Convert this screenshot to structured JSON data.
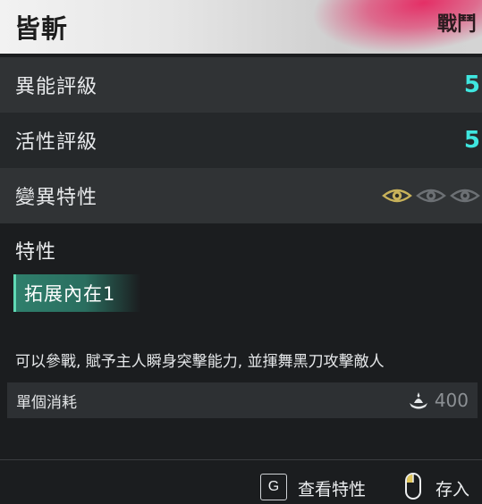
{
  "header": {
    "title": "皆斬",
    "tag": "戰鬥",
    "accent_color": "#e52660"
  },
  "stats": [
    {
      "label": "異能評級",
      "value": "5"
    },
    {
      "label": "活性評級",
      "value": "5"
    }
  ],
  "mutation": {
    "label": "變異特性",
    "icons": [
      "eye-icon-active",
      "eye-icon-inactive",
      "eye-icon-inactive"
    ],
    "active_color": "#c8b25a",
    "inactive_color": "#6c7074"
  },
  "traits": {
    "section_title": "特性",
    "selected": "拓展內在1"
  },
  "description": "可以參戰, 賦予主人瞬身突擊能力, 並揮舞黑刀攻擊敵人",
  "cost": {
    "label": "單個消耗",
    "icon": "resource-icon",
    "value": "400"
  },
  "footer": {
    "view_key": "G",
    "view_label": "查看特性",
    "store_icon": "mouse-icon",
    "store_label": "存入"
  },
  "value_color": "#3fe6df"
}
